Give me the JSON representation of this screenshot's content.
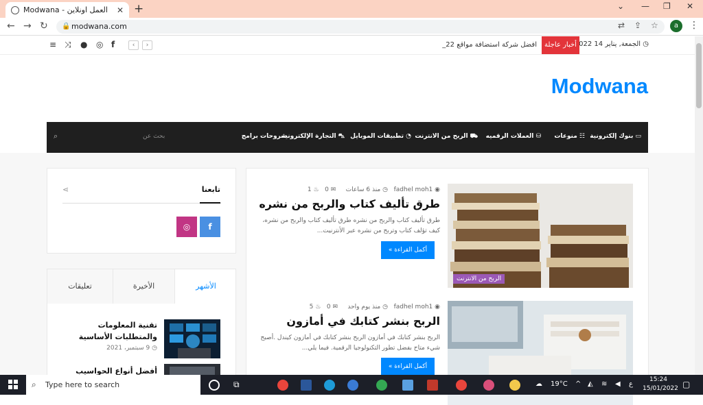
{
  "browser": {
    "tab_title": "Modwana - العمل اونلاين",
    "tab_close": "✕",
    "new_tab": "+",
    "url": "modwana.com",
    "profile_initial": "a"
  },
  "topbar": {
    "date": "الجمعة, يناير 14 2022",
    "breaking_label": "أخبار عاجلة",
    "breaking_text": "افضل شركة استضافة مواقع 22_"
  },
  "site": {
    "brand": "Modwana",
    "search_placeholder": "بحث عن"
  },
  "nav": {
    "items": [
      "بنوك إلكترونية",
      "منوعات",
      "العملات الرقميه",
      "الربح من الانترنت",
      "تطبيقات الموبايل",
      "التجارة الإلكترونية",
      "شروحات برامج"
    ]
  },
  "posts": [
    {
      "category": "الربح من الانترنت",
      "author": "fadhel moh1",
      "time": "منذ 6 ساعات",
      "comments": "0",
      "views": "1",
      "title": "طرق تأليف كتاب والربح  من نشره",
      "excerpt": "طرق تأليف كتاب والربح  من نشره طرق تأليف كتاب والربح  من نشره، كيف تؤلف كتاب وتربح من نشره عبر الأنترنيت...",
      "more": "أكمل القراءة »"
    },
    {
      "category": "",
      "author": "fadhel moh1",
      "time": "منذ يوم واحد",
      "comments": "0",
      "views": "5",
      "title": "الربح بنشر كتابك في أمازون",
      "excerpt": "الربح بنشر كتابك في أمازون الربح بنشر كتابك في أمازون كيندل .أصبح شيء متاح بفضل تطور التكنولوجيا الرقمية. فيما يلي...",
      "more": "أكمل القراءة »"
    }
  ],
  "sidebar": {
    "follow_title": "تابعنا",
    "tabs": [
      "الأشهر",
      "الأخيرة",
      "تعليقات"
    ],
    "widget_posts": [
      {
        "title": "تقنية المعلومات والمتطلبات الأساسية",
        "date": "9 سبتمبر، 2021"
      },
      {
        "title": "أفضل أنواع الحواسيب",
        "date": ""
      }
    ]
  },
  "taskbar": {
    "search_placeholder": "Type here to search",
    "temperature": "19°C",
    "lang": "ع",
    "time": "15:24",
    "date": "15/01/2022"
  },
  "colors": {
    "accent": "#0088ff",
    "breaking": "#e3343a",
    "category": "#9b59b6",
    "nav_bg": "#1f1f1f",
    "facebook": "#4a90e2",
    "instagram": "#c13584"
  }
}
